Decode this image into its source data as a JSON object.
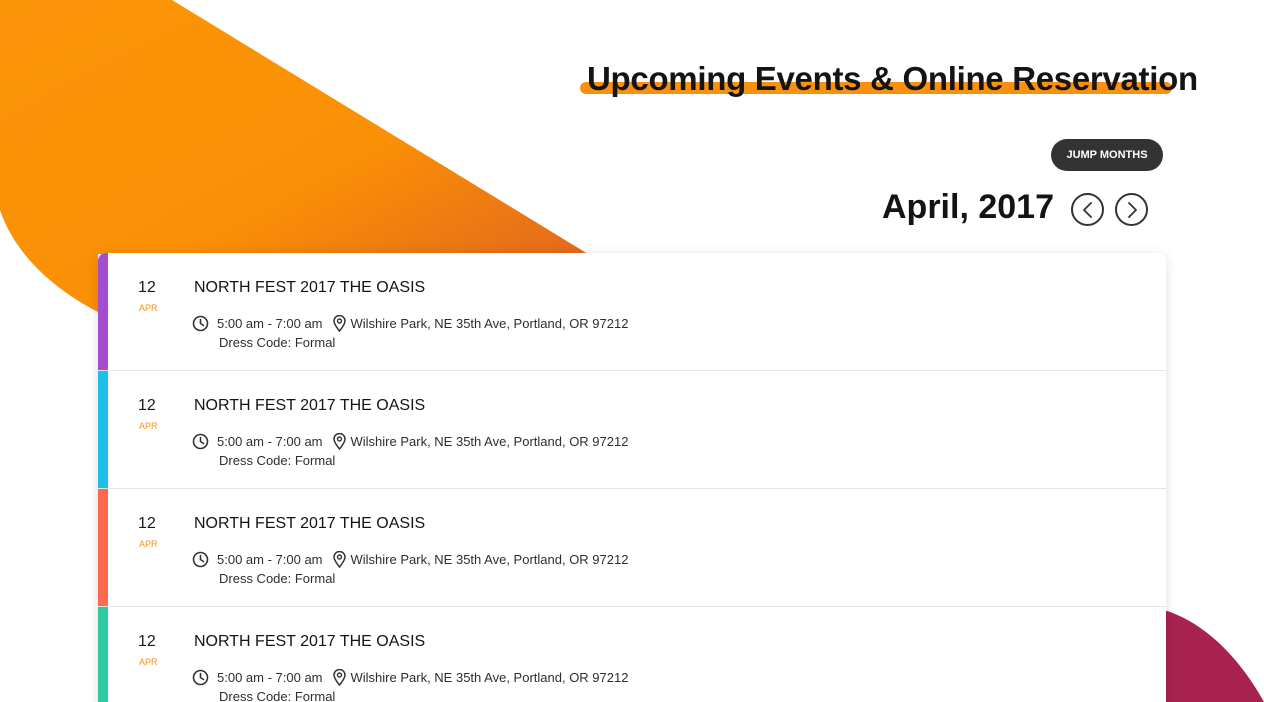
{
  "header": {
    "title": "Upcoming Events & Online Reservation"
  },
  "controls": {
    "jump_label": "JUMP MONTHS",
    "month_label": "April, 2017"
  },
  "colors": {
    "accent_orange": "#f9910f",
    "bar_colors": [
      "#a64dcf",
      "#1cc0e6",
      "#fb6a4f",
      "#2ec9a0"
    ]
  },
  "events": [
    {
      "day": "12",
      "month": "APR",
      "title": "NORTH FEST 2017 THE OASIS",
      "time": "5:00 am - 7:00 am",
      "location": "Wilshire Park, NE 35th Ave, Portland, OR 97212",
      "dress": "Dress Code: Formal"
    },
    {
      "day": "12",
      "month": "APR",
      "title": "NORTH FEST 2017 THE OASIS",
      "time": "5:00 am - 7:00 am",
      "location": "Wilshire Park, NE 35th Ave, Portland, OR 97212",
      "dress": "Dress Code: Formal"
    },
    {
      "day": "12",
      "month": "APR",
      "title": "NORTH FEST 2017 THE OASIS",
      "time": "5:00 am - 7:00 am",
      "location": "Wilshire Park, NE 35th Ave, Portland, OR 97212",
      "dress": "Dress Code: Formal"
    },
    {
      "day": "12",
      "month": "APR",
      "title": "NORTH FEST 2017 THE OASIS",
      "time": "5:00 am - 7:00 am",
      "location": "Wilshire Park, NE 35th Ave, Portland, OR 97212",
      "dress": "Dress Code: Formal"
    }
  ]
}
